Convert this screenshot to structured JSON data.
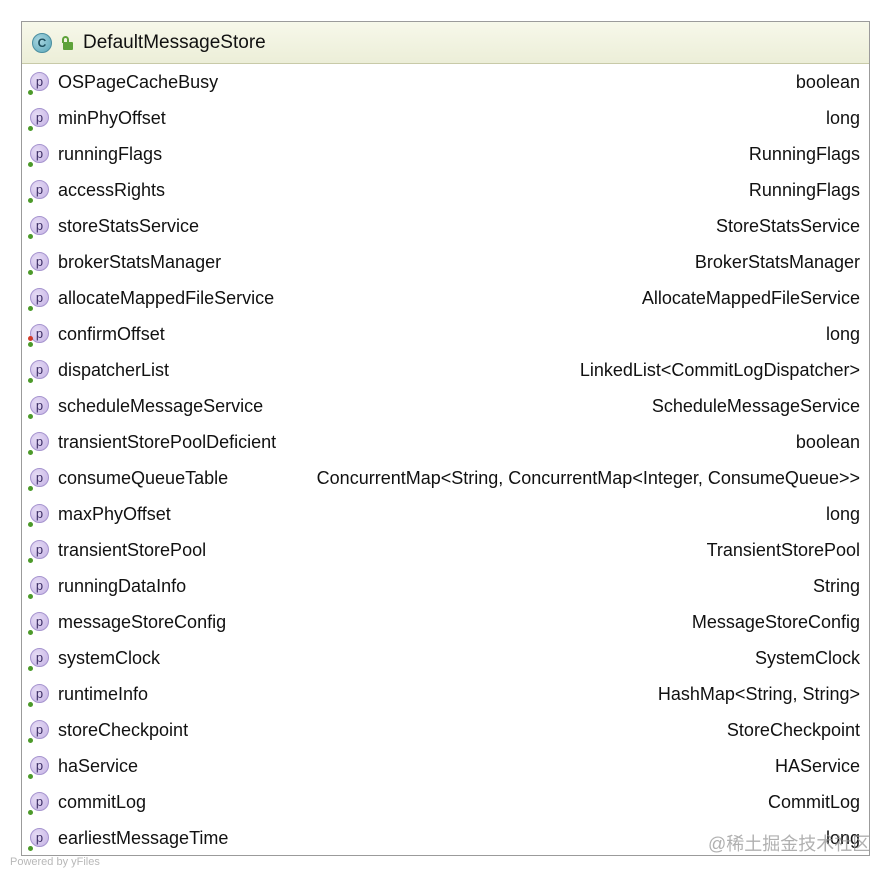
{
  "class_title": "DefaultMessageStore",
  "class_icon_label": "C",
  "property_icon_label": "p",
  "properties": [
    {
      "name": "OSPageCacheBusy",
      "type": "boolean"
    },
    {
      "name": "minPhyOffset",
      "type": "long"
    },
    {
      "name": "runningFlags",
      "type": "RunningFlags"
    },
    {
      "name": "accessRights",
      "type": "RunningFlags"
    },
    {
      "name": "storeStatsService",
      "type": "StoreStatsService"
    },
    {
      "name": "brokerStatsManager",
      "type": "BrokerStatsManager"
    },
    {
      "name": "allocateMappedFileService",
      "type": "AllocateMappedFileService"
    },
    {
      "name": "confirmOffset",
      "type": "long"
    },
    {
      "name": "dispatcherList",
      "type": "LinkedList<CommitLogDispatcher>"
    },
    {
      "name": "scheduleMessageService",
      "type": "ScheduleMessageService"
    },
    {
      "name": "transientStorePoolDeficient",
      "type": "boolean"
    },
    {
      "name": "consumeQueueTable",
      "type": "ConcurrentMap<String, ConcurrentMap<Integer, ConsumeQueue>>"
    },
    {
      "name": "maxPhyOffset",
      "type": "long"
    },
    {
      "name": "transientStorePool",
      "type": "TransientStorePool"
    },
    {
      "name": "runningDataInfo",
      "type": "String"
    },
    {
      "name": "messageStoreConfig",
      "type": "MessageStoreConfig"
    },
    {
      "name": "systemClock",
      "type": "SystemClock"
    },
    {
      "name": "runtimeInfo",
      "type": "HashMap<String, String>"
    },
    {
      "name": "storeCheckpoint",
      "type": "StoreCheckpoint"
    },
    {
      "name": "haService",
      "type": "HAService"
    },
    {
      "name": "commitLog",
      "type": "CommitLog"
    },
    {
      "name": "earliestMessageTime",
      "type": "long"
    }
  ],
  "footer_note": "Powered by yFiles",
  "watermark": "@稀土掘金技术社区",
  "colors": {
    "header_bg": "#eceed8",
    "border": "#9b9b9b",
    "property_icon": "#c4b2e4",
    "class_icon": "#58a6b8",
    "visibility_green": "#4c9a2a",
    "visibility_red": "#d23c2a"
  }
}
